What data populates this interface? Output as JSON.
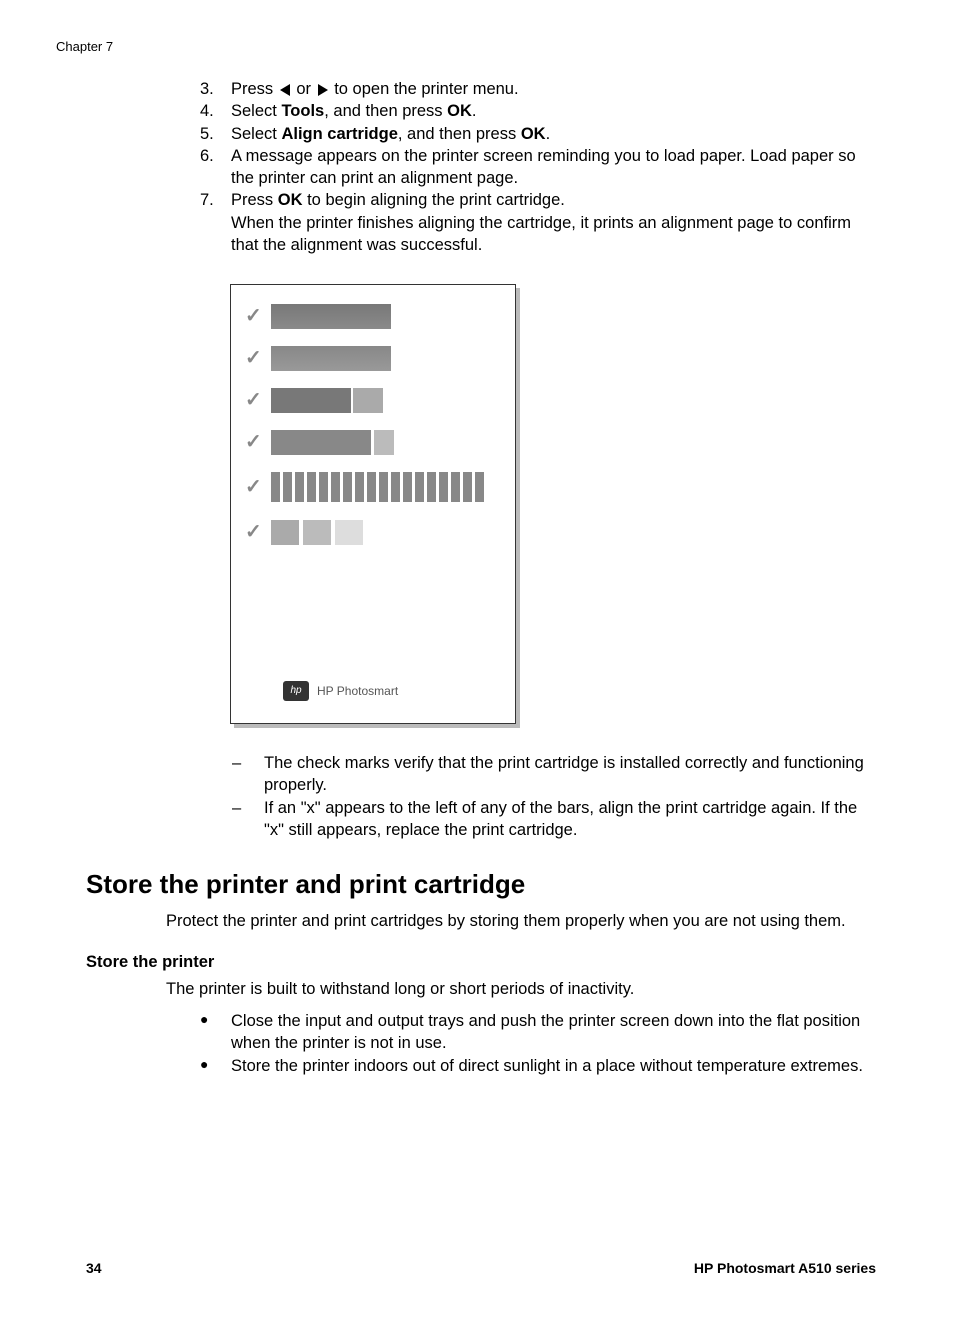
{
  "chapter": "Chapter 7",
  "steps": {
    "s3_pre": "Press ",
    "s3_mid": " or ",
    "s3_post": " to open the printer menu.",
    "s4a": "Select ",
    "s4b": "Tools",
    "s4c": ", and then press ",
    "s4d": "OK",
    "s4e": ".",
    "s5a": "Select ",
    "s5b": "Align cartridge",
    "s5c": ", and then press ",
    "s5d": "OK",
    "s5e": ".",
    "s6": "A message appears on the printer screen reminding you to load paper. Load paper so the printer can print an alignment page.",
    "s7a": "Press ",
    "s7b": "OK",
    "s7c": " to begin aligning the print cartridge.",
    "s7d": "When the printer finishes aligning the cartridge, it prints an alignment page to confirm that the alignment was successful."
  },
  "nums": {
    "n3": "3.",
    "n4": "4.",
    "n5": "5.",
    "n6": "6.",
    "n7": "7."
  },
  "dashes": {
    "d1": "The check marks verify that the print cartridge is installed correctly and functioning properly.",
    "d2": "If an \"x\" appears to the left of any of the bars, align the print cartridge again. If the \"x\" still appears, replace the print cartridge."
  },
  "section_title": "Store the printer and print cartridge",
  "section_para": "Protect the printer and print cartridges by storing them properly when you are not using them.",
  "sub_title": "Store the printer",
  "sub_para": "The printer is built to withstand long or short periods of inactivity.",
  "bullets": {
    "b1": "Close the input and output trays and push the printer screen down into the flat position when the printer is not in use.",
    "b2": "Store the printer indoors out of direct sunlight in a place without temperature extremes."
  },
  "hplabel": "HP Photosmart",
  "footer": {
    "page": "34",
    "product": "HP Photosmart A510 series"
  },
  "dash_char": "–",
  "bullet_char": "●"
}
